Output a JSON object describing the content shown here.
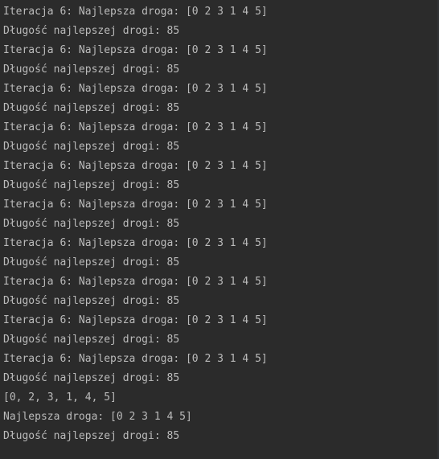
{
  "console": {
    "lines": [
      "Iteracja 6: Najlepsza droga: [0 2 3 1 4 5]",
      "Długość najlepszej drogi: 85",
      "Iteracja 6: Najlepsza droga: [0 2 3 1 4 5]",
      "Długość najlepszej drogi: 85",
      "Iteracja 6: Najlepsza droga: [0 2 3 1 4 5]",
      "Długość najlepszej drogi: 85",
      "Iteracja 6: Najlepsza droga: [0 2 3 1 4 5]",
      "Długość najlepszej drogi: 85",
      "Iteracja 6: Najlepsza droga: [0 2 3 1 4 5]",
      "Długość najlepszej drogi: 85",
      "Iteracja 6: Najlepsza droga: [0 2 3 1 4 5]",
      "Długość najlepszej drogi: 85",
      "Iteracja 6: Najlepsza droga: [0 2 3 1 4 5]",
      "Długość najlepszej drogi: 85",
      "Iteracja 6: Najlepsza droga: [0 2 3 1 4 5]",
      "Długość najlepszej drogi: 85",
      "Iteracja 6: Najlepsza droga: [0 2 3 1 4 5]",
      "Długość najlepszej drogi: 85",
      "Iteracja 6: Najlepsza droga: [0 2 3 1 4 5]",
      "Długość najlepszej drogi: 85",
      "[0, 2, 3, 1, 4, 5]",
      "Najlepsza droga: [0 2 3 1 4 5]",
      "Długość najlepszej drogi: 85"
    ]
  },
  "colors": {
    "background": "#2b2b2b",
    "text": "#bbbbbb"
  }
}
